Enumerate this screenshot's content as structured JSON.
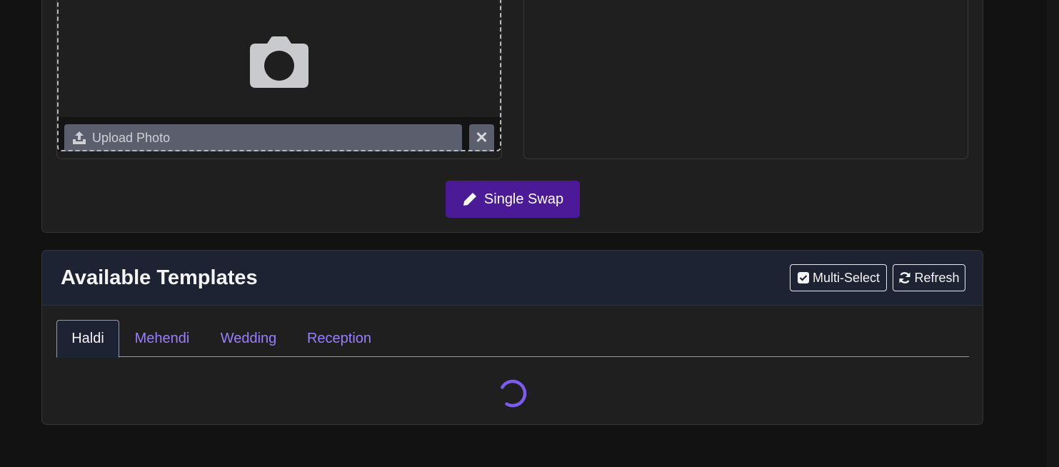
{
  "upload": {
    "button_label": "Upload Photo",
    "clear_symbol": "✕",
    "camera_icon": "camera-icon",
    "upload_icon": "upload-icon"
  },
  "actions": {
    "single_swap_label": "Single Swap",
    "single_swap_icon": "pen-icon"
  },
  "templates": {
    "title": "Available Templates",
    "multi_select_label": "Multi-Select",
    "refresh_label": "Refresh",
    "tabs": [
      {
        "label": "Haldi",
        "active": true
      },
      {
        "label": "Mehendi",
        "active": false
      },
      {
        "label": "Wedding",
        "active": false
      },
      {
        "label": "Reception",
        "active": false
      }
    ],
    "loading": true
  },
  "colors": {
    "page_bg": "#121212",
    "card_bg": "#1f1f1f",
    "header_bg": "#1e2333",
    "primary_button": "#4b1a96",
    "tab_link": "#9b7dff",
    "spinner": "#7c5cf0",
    "upload_button": "#5b5f6d"
  }
}
